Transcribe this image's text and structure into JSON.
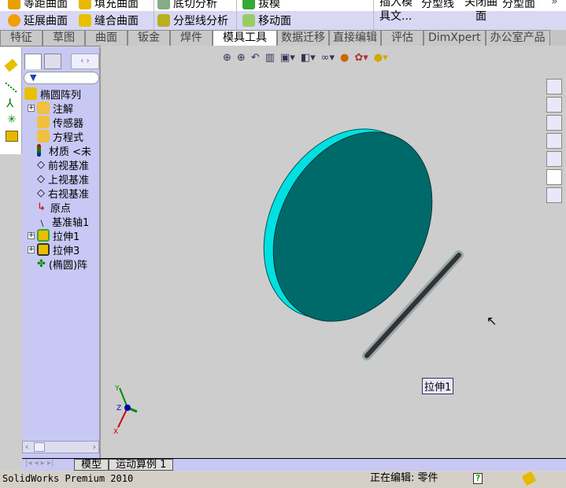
{
  "command_bar": {
    "row1": [
      "等距曲面",
      "填充曲面",
      "底切分析",
      "拔模"
    ],
    "row2": [
      "延展曲面",
      "缝合曲面",
      "分型线分析",
      "移动面"
    ],
    "right": [
      "插入模具文...",
      "分型线",
      "关闭曲面",
      "分型面"
    ]
  },
  "tabs": [
    "特征",
    "草图",
    "曲面",
    "钣金",
    "焊件",
    "模具工具",
    "数据迁移",
    "直接编辑",
    "评估",
    "DimXpert",
    "办公室产品"
  ],
  "active_tab": "模具工具",
  "tree": {
    "root": "椭圆阵列",
    "items": [
      "注解",
      "传感器",
      "方程式",
      "材质 <未",
      "前视基准",
      "上视基准",
      "右视基准",
      "原点",
      "基准轴1",
      "拉伸1",
      "拉伸3",
      "(椭圆)阵"
    ]
  },
  "viewport": {
    "tooltip": "拉伸1",
    "triad": {
      "x": "X",
      "y": "Y",
      "z": "Z"
    }
  },
  "bottom_tabs": [
    "模型",
    "运动算例 1"
  ],
  "status": {
    "app": "SolidWorks Premium 2010",
    "editing": "正在编辑: 零件",
    "help": "?"
  },
  "colors": {
    "body": "#006a6a",
    "edge": "#00e8e8",
    "panel": "#c8c8f4"
  }
}
